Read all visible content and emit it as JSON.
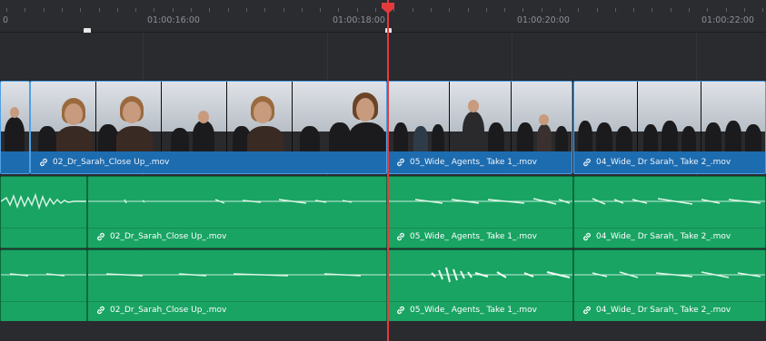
{
  "ruler": {
    "labels": [
      "0",
      "01:00:16:00",
      "01:00:18:00",
      "01:00:20:00",
      "01:00:22:00"
    ]
  },
  "tracks": {
    "video": {
      "clips": [
        {
          "name": "",
          "partial": true
        },
        {
          "name": "02_Dr_Sarah_Close Up_.mov"
        },
        {
          "name": "05_Wide_ Agents_ Take 1_.mov"
        },
        {
          "name": "04_Wide_ Dr Sarah_ Take 2_.mov"
        }
      ]
    },
    "audio1": {
      "clips": [
        {
          "name": ""
        },
        {
          "name": "02_Dr_Sarah_Close Up_.mov"
        },
        {
          "name": "05_Wide_ Agents_ Take 1_.mov"
        },
        {
          "name": "04_Wide_ Dr Sarah_ Take 2_.mov"
        }
      ]
    },
    "audio2": {
      "clips": [
        {
          "name": ""
        },
        {
          "name": "02_Dr_Sarah_Close Up_.mov"
        },
        {
          "name": "05_Wide_ Agents_ Take 1_.mov"
        },
        {
          "name": "04_Wide_ Dr Sarah_ Take 2_.mov"
        }
      ]
    }
  },
  "icons": {
    "link": "link-icon",
    "playhead": "playhead-marker",
    "clip-marker": "marker-flag"
  },
  "colors": {
    "video_clip": "#1e6fb3",
    "audio_clip": "#19a463",
    "playhead": "#e33b3b",
    "background": "#2a2b2f"
  }
}
